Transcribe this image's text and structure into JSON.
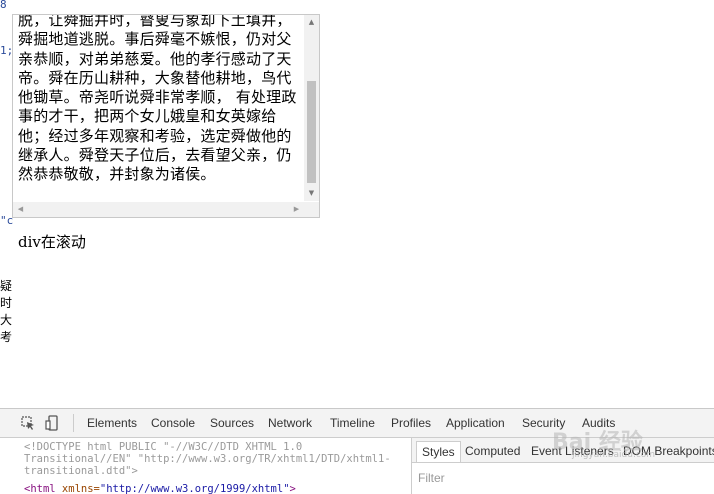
{
  "edge_fragments": [
    "1;",
    "\"c",
    "疑",
    "时",
    "大",
    "考"
  ],
  "scroll_text": "脱，让舜掘井时，瞽叟与象却下土填井，舜掘地道逃脱。事后舜毫不嫉恨，仍对父亲恭顺，对弟弟慈爱。他的孝行感动了天帝。舜在历山耕种，大象替他耕地，鸟代他锄草。帝尧听说舜非常孝顺， 有处理政事的才干，把两个女儿娥皇和女英嫁给他；经过多年观察和考验，选定舜做他的继承人。舜登天子位后，去看望父亲，仍然恭恭敬敬，并封象为诸侯。",
  "status": "div在滚动",
  "devtools": {
    "tabs": [
      "Elements",
      "Console",
      "Sources",
      "Network",
      "Timeline",
      "Profiles",
      "Application",
      "Security",
      "Audits"
    ],
    "doctype_lines": [
      "<!DOCTYPE html PUBLIC \"-//W3C//DTD XHTML 1.0",
      "Transitional//EN\" \"http://www.w3.org/TR/xhtml1/DTD/xhtml1-",
      "transitional.dtd\">"
    ],
    "html_tag": {
      "tag": "<html",
      "attr": " xmlns=",
      "value": "\"http://www.w3.org/1999/xhtml\"",
      "close": ">"
    },
    "side_tabs": [
      "Styles",
      "Computed",
      "Event Listeners",
      "DOM Breakpoints"
    ],
    "filter_placeholder": "Filter"
  },
  "watermark": {
    "text": "Bai 经验",
    "sub": "jingyan.baidu.com"
  },
  "colors": {
    "accent_tag": "#881280",
    "accent_attr": "#994500",
    "accent_value": "#1a1aa6"
  }
}
